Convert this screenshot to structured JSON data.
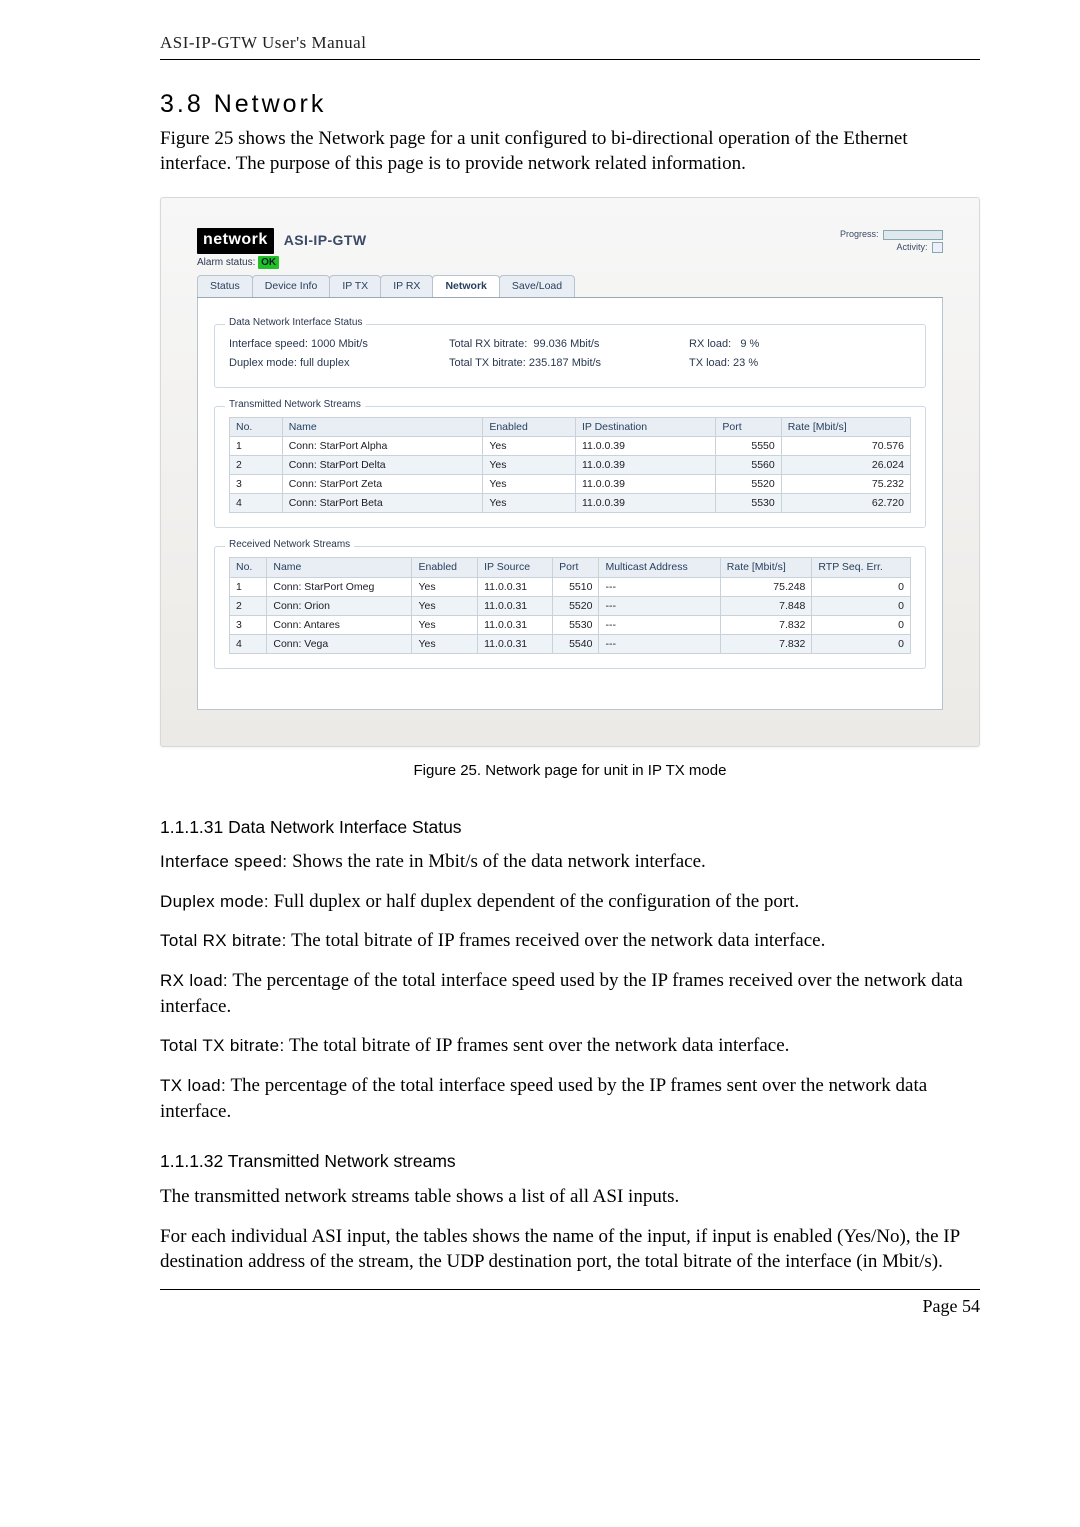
{
  "header": {
    "running": "ASI-IP-GTW User's Manual"
  },
  "section": {
    "heading": "3.8 Network",
    "intro": "Figure 25 shows the Network page for a unit configured to bi-directional operation of the Ethernet interface. The purpose of this page is to provide network related information."
  },
  "app": {
    "logo": "network",
    "device": "ASI-IP-GTW",
    "progress_label": "Progress:",
    "activity_label": "Activity:",
    "alarm_label": "Alarm status:",
    "alarm_value": "OK",
    "tabs": [
      "Status",
      "Device Info",
      "IP TX",
      "IP RX",
      "Network",
      "Save/Load"
    ],
    "active_tab_index": 4,
    "iface_status": {
      "legend": "Data Network Interface Status",
      "rows": {
        "iface_speed_label": "Interface speed:",
        "iface_speed_val": "1000 Mbit/s",
        "duplex_label": "Duplex mode:",
        "duplex_val": "full duplex",
        "totrx_label": "Total RX bitrate:",
        "totrx_val": "99.036 Mbit/s",
        "tottx_label": "Total TX bitrate:",
        "tottx_val": "235.187 Mbit/s",
        "rxload_label": "RX load:",
        "rxload_val": "9 %",
        "txload_label": "TX load:",
        "txload_val": "23 %"
      }
    },
    "tx_streams": {
      "legend": "Transmitted Network Streams",
      "columns": [
        "No.",
        "Name",
        "Enabled",
        "IP Destination",
        "Port",
        "Rate [Mbit/s]"
      ],
      "rows": [
        {
          "no": "1",
          "name": "Conn: StarPort Alpha",
          "en": "Yes",
          "ip": "11.0.0.39",
          "port": "5550",
          "rate": "70.576"
        },
        {
          "no": "2",
          "name": "Conn: StarPort Delta",
          "en": "Yes",
          "ip": "11.0.0.39",
          "port": "5560",
          "rate": "26.024"
        },
        {
          "no": "3",
          "name": "Conn: StarPort Zeta",
          "en": "Yes",
          "ip": "11.0.0.39",
          "port": "5520",
          "rate": "75.232"
        },
        {
          "no": "4",
          "name": "Conn: StarPort Beta",
          "en": "Yes",
          "ip": "11.0.0.39",
          "port": "5530",
          "rate": "62.720"
        }
      ]
    },
    "rx_streams": {
      "legend": "Received Network Streams",
      "columns": [
        "No.",
        "Name",
        "Enabled",
        "IP Source",
        "Port",
        "Multicast Address",
        "Rate [Mbit/s]",
        "RTP Seq. Err."
      ],
      "rows": [
        {
          "no": "1",
          "name": "Conn: StarPort Omeg",
          "en": "Yes",
          "ip": "11.0.0.31",
          "port": "5510",
          "mc": "---",
          "rate": "75.248",
          "err": "0"
        },
        {
          "no": "2",
          "name": "Conn: Orion",
          "en": "Yes",
          "ip": "11.0.0.31",
          "port": "5520",
          "mc": "---",
          "rate": "7.848",
          "err": "0"
        },
        {
          "no": "3",
          "name": "Conn: Antares",
          "en": "Yes",
          "ip": "11.0.0.31",
          "port": "5530",
          "mc": "---",
          "rate": "7.832",
          "err": "0"
        },
        {
          "no": "4",
          "name": "Conn: Vega",
          "en": "Yes",
          "ip": "11.0.0.31",
          "port": "5540",
          "mc": "---",
          "rate": "7.832",
          "err": "0"
        }
      ]
    }
  },
  "caption": "Figure 25. Network page for unit in IP TX mode",
  "sub1": {
    "title": "1.1.1.31 Data Network Interface Status",
    "items": [
      {
        "term": "Interface speed:",
        "text": " Shows the rate in Mbit/s of the data network interface."
      },
      {
        "term": "Duplex mode:",
        "text": " Full duplex or half duplex dependent of the configuration of the port."
      },
      {
        "term": "Total RX bitrate:",
        "text": " The total bitrate of IP frames received over the network data interface."
      },
      {
        "term": "RX load:",
        "text": " The percentage of the total interface speed used by the IP frames received over the network data interface."
      },
      {
        "term": "Total TX bitrate:",
        "text": " The total bitrate of IP frames sent over the network data interface."
      },
      {
        "term": "TX load:",
        "text": " The percentage of the total interface speed used by the IP frames sent over the network data interface."
      }
    ]
  },
  "sub2": {
    "title": "1.1.1.32 Transmitted Network streams",
    "p1": "The transmitted network streams table shows a list of all ASI inputs.",
    "p2": "For each individual ASI input, the tables shows the name of the input, if input is enabled (Yes/No), the IP destination address of the stream, the UDP destination port, the total bitrate of the interface (in Mbit/s)."
  },
  "footer": {
    "page": "Page 54"
  }
}
